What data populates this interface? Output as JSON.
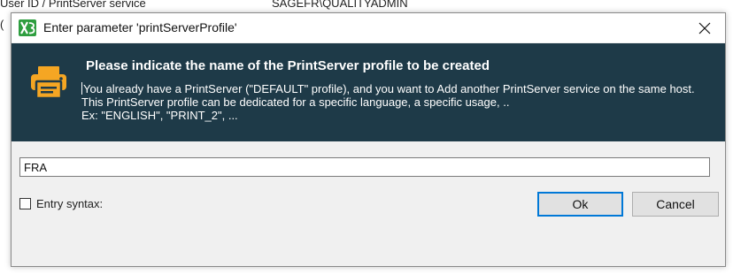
{
  "background": {
    "label": "User ID / PrintServer service",
    "value": "SAGEFR\\QUALITYADMIN",
    "left_cut_char": "("
  },
  "dialog": {
    "title": "Enter parameter 'printServerProfile'",
    "close_glyph": "✕",
    "header": {
      "title": "Please indicate the name of the PrintServer profile to be created",
      "lines": [
        "You already have a PrintServer (\"DEFAULT\" profile), and you want to Add another PrintServer service on the same host.",
        "This PrintServer profile can be dedicated for a specific language, a specific usage, ..",
        "Ex: \"ENGLISH\", \"PRINT_2\", ..."
      ],
      "icon": "printer-icon",
      "icon_color": "#f5a623",
      "background_color": "#1e3a48"
    },
    "input_value": "FRA",
    "entry_syntax_label": "Entry syntax:",
    "entry_syntax_checked": false,
    "ok_label": "Ok",
    "cancel_label": "Cancel",
    "accent_color": "#0078d7",
    "app_icon": "x3-app-icon"
  }
}
